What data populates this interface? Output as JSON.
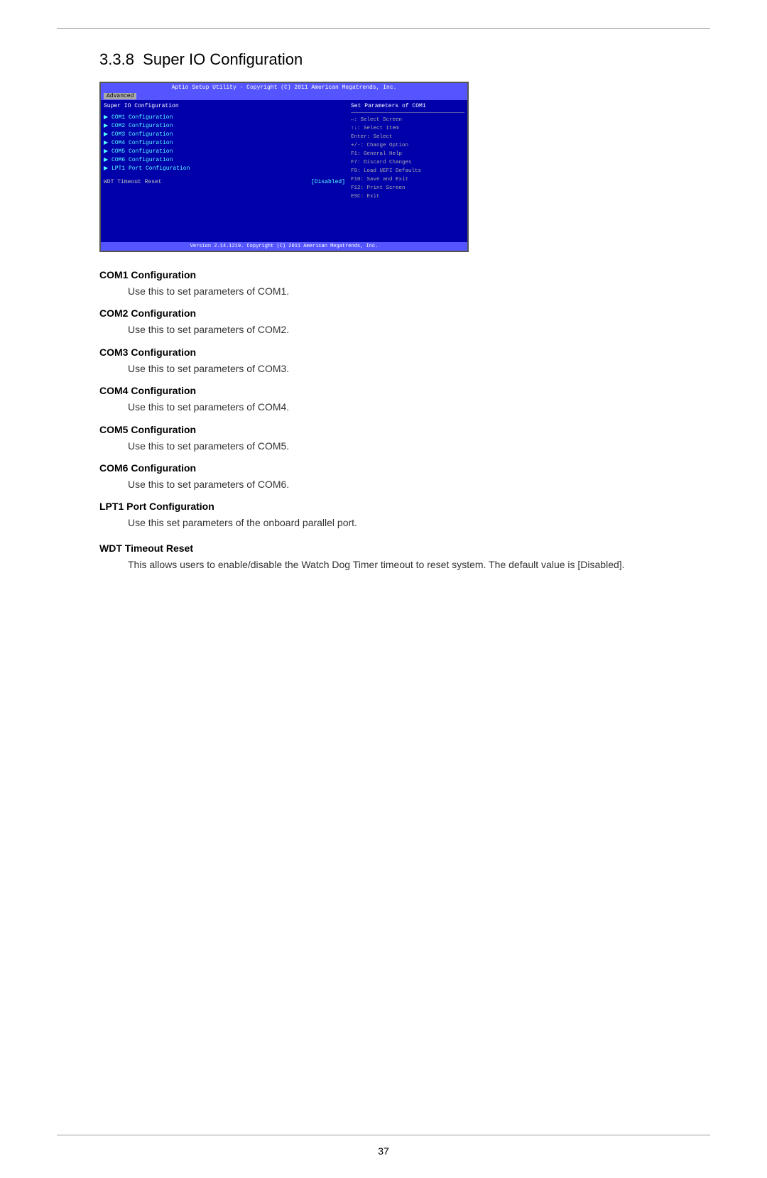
{
  "page": {
    "top_rule": true,
    "section_number": "3.3.8",
    "section_title": "Super IO Configuration",
    "page_number": "37"
  },
  "bios": {
    "header_text": "Aptio Setup Utility - Copyright (C) 2011 American Megatrends, Inc.",
    "tab_label": "Advanced",
    "left_panel": {
      "section_label": "Super IO Configuration",
      "menu_items": [
        "COM1 Configuration",
        "COM2 Configuration",
        "COM3 Configuration",
        "COM4 Configuration",
        "COM5 Configuration",
        "COM6 Configuration",
        "LPT1 Port Configuration"
      ],
      "option_label": "WDT Timeout Reset",
      "option_value": "[Disabled]"
    },
    "right_panel": {
      "help_text": "Set Parameters of COM1",
      "keys": [
        "↔: Select Screen",
        "↑↓: Select Item",
        "Enter: Select",
        "+/-: Change Option",
        "F1: General Help",
        "F7: Discard Changes",
        "F9: Load UEFI Defaults",
        "F10: Save and Exit",
        "F12: Print Screen",
        "ESC: Exit"
      ]
    },
    "footer_text": "Version 2.14.1219. Copyright (C) 2011 American Megatrends, Inc."
  },
  "docs": [
    {
      "id": "com1",
      "term": "COM1 Configuration",
      "desc": "Use this to set parameters of COM1."
    },
    {
      "id": "com2",
      "term": "COM2 Configuration",
      "desc": "Use this to set parameters of COM2."
    },
    {
      "id": "com3",
      "term": "COM3 Configuration",
      "desc": "Use this to set parameters of COM3."
    },
    {
      "id": "com4",
      "term": "COM4 Configuration",
      "desc": "Use this to set parameters of COM4."
    },
    {
      "id": "com5",
      "term": "COM5 Configuration",
      "desc": "Use this to set parameters of COM5."
    },
    {
      "id": "com6",
      "term": "COM6 Configuration",
      "desc": "Use this to set parameters of COM6."
    },
    {
      "id": "lpt1",
      "term": "LPT1 Port Configuration",
      "desc": "Use this set parameters of the onboard parallel port."
    },
    {
      "id": "wdt",
      "term": "WDT Timeout Reset",
      "desc": "This allows users to enable/disable the Watch Dog Timer timeout to reset system. The default value is [Disabled]."
    }
  ]
}
